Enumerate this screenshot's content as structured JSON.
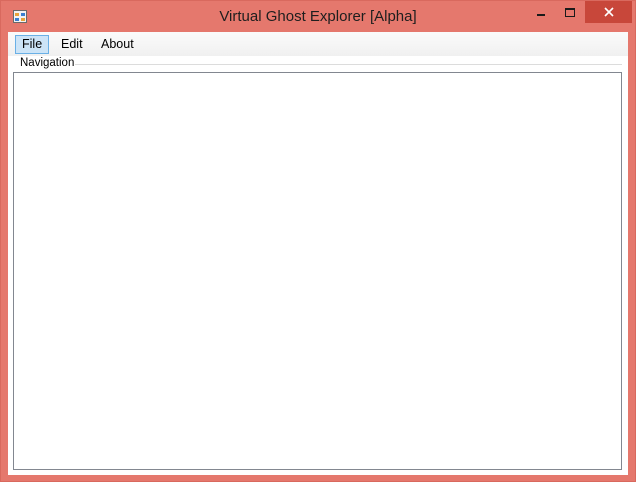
{
  "window": {
    "title": "Virtual Ghost Explorer [Alpha]",
    "accent_color": "#e5786d",
    "close_color": "#c8473a",
    "icons": {
      "app": "app-window-icon",
      "minimize": "minimize-icon",
      "maximize": "maximize-icon",
      "close": "close-icon"
    }
  },
  "menu": {
    "items": [
      {
        "label": "File",
        "active": true
      },
      {
        "label": "Edit",
        "active": false
      },
      {
        "label": "About",
        "active": false
      }
    ]
  },
  "navigation": {
    "label": "Navigation"
  }
}
